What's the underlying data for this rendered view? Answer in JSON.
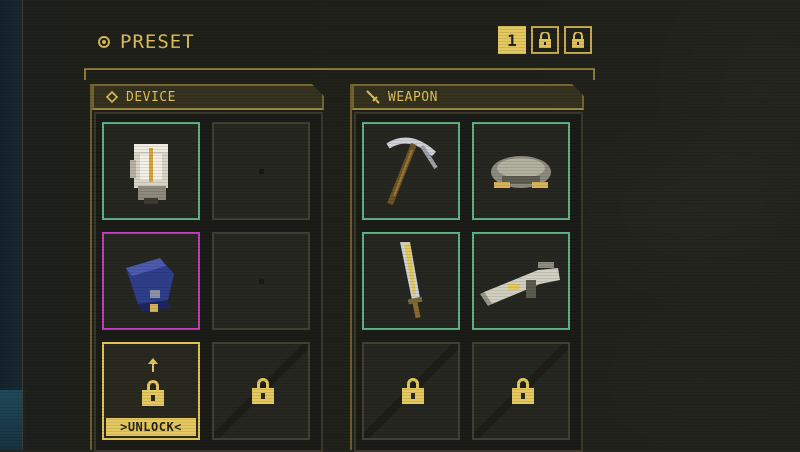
{
  "preset": {
    "title": "PRESET",
    "tabs": [
      {
        "label": "1",
        "state": "active"
      },
      {
        "label": "",
        "state": "locked"
      },
      {
        "label": "",
        "state": "locked"
      }
    ]
  },
  "device": {
    "title": "DEVICE",
    "slots": [
      {
        "state": "equipped",
        "item": "white-backpack-device-icon",
        "rarity_color": "#5fb487"
      },
      {
        "state": "empty"
      },
      {
        "state": "equipped",
        "item": "blue-pod-device-icon",
        "rarity_color": "#c03fba"
      },
      {
        "state": "empty"
      },
      {
        "state": "unlockable",
        "action_label": ">UNLOCK<"
      },
      {
        "state": "locked"
      }
    ]
  },
  "weapon": {
    "title": "WEAPON",
    "slots": [
      {
        "state": "equipped",
        "item": "pickaxe-weapon-icon",
        "rarity_color": "#5fb487"
      },
      {
        "state": "equipped",
        "item": "drone-weapon-icon",
        "rarity_color": "#5fb487"
      },
      {
        "state": "equipped",
        "item": "sword-weapon-icon",
        "rarity_color": "#5fb487"
      },
      {
        "state": "equipped",
        "item": "cannon-weapon-icon",
        "rarity_color": "#5fb487"
      },
      {
        "state": "locked"
      },
      {
        "state": "locked"
      }
    ]
  },
  "colors": {
    "accent": "#e6c860",
    "rarity_green": "#5fb487",
    "rarity_magenta": "#c03fba"
  }
}
